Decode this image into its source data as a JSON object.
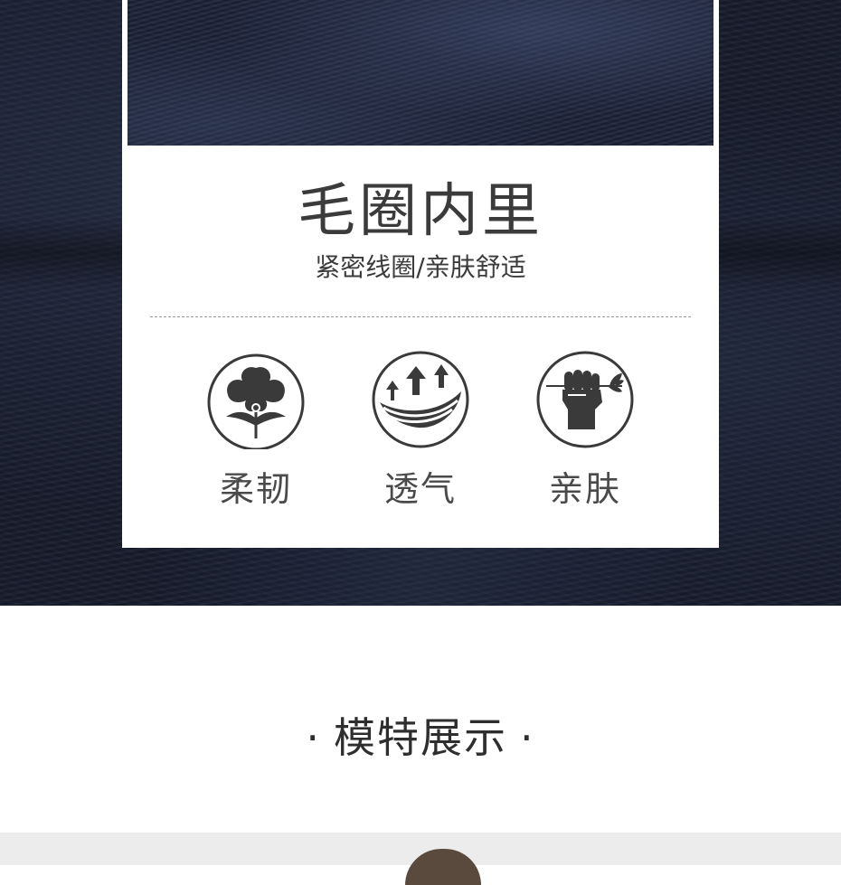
{
  "feature_card": {
    "title": "毛圈内里",
    "subtitle": "紧密线圈/亲肤舒适",
    "features": [
      {
        "label": "柔韧",
        "icon": "cotton-flower-icon"
      },
      {
        "label": "透气",
        "icon": "breathable-arrows-icon"
      },
      {
        "label": "亲肤",
        "icon": "hand-leaf-icon"
      }
    ]
  },
  "section": {
    "title": "模特展示",
    "dot_left": "·",
    "dot_right": "·"
  },
  "colors": {
    "fabric": "#161b2b",
    "icon_fill": "#3a3a3a",
    "text_dark": "#3b3b3b"
  }
}
